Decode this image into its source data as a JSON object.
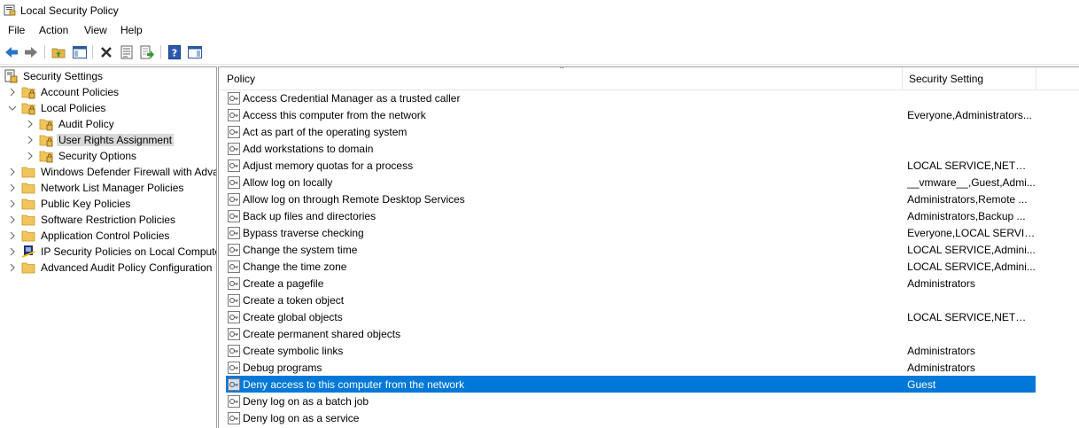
{
  "window": {
    "title": "Local Security Policy"
  },
  "menu": [
    "File",
    "Action",
    "View",
    "Help"
  ],
  "toolbar": {
    "icons": [
      "back-arrow-icon",
      "forward-arrow-icon",
      "up-folder-icon",
      "show-hide-console-tree-icon",
      "delete-icon",
      "properties-icon",
      "export-list-icon",
      "help-icon",
      "show-hide-action-pane-icon"
    ]
  },
  "tree": [
    {
      "label": "Security Settings",
      "level": 0,
      "expanded": true
    },
    {
      "label": "Account Policies",
      "level": 1,
      "expanded": false
    },
    {
      "label": "Local Policies",
      "level": 1,
      "expanded": true
    },
    {
      "label": "Audit Policy",
      "level": 2,
      "expanded": false
    },
    {
      "label": "User Rights Assignment",
      "level": 2,
      "expanded": false,
      "selected": true
    },
    {
      "label": "Security Options",
      "level": 2,
      "expanded": false
    },
    {
      "label": "Windows Defender Firewall with Adva",
      "level": 1,
      "expanded": false
    },
    {
      "label": "Network List Manager Policies",
      "level": 1,
      "expanded": false
    },
    {
      "label": "Public Key Policies",
      "level": 1,
      "expanded": false
    },
    {
      "label": "Software Restriction Policies",
      "level": 1,
      "expanded": false
    },
    {
      "label": "Application Control Policies",
      "level": 1,
      "expanded": false
    },
    {
      "label": "IP Security Policies on Local Compute",
      "level": 1,
      "expanded": false
    },
    {
      "label": "Advanced Audit Policy Configuration",
      "level": 1,
      "expanded": false
    }
  ],
  "list": {
    "columns": [
      "Policy",
      "Security Setting"
    ],
    "rows": [
      {
        "policy": "Access Credential Manager as a trusted caller",
        "setting": ""
      },
      {
        "policy": "Access this computer from the network",
        "setting": "Everyone,Administrators..."
      },
      {
        "policy": "Act as part of the operating system",
        "setting": ""
      },
      {
        "policy": "Add workstations to domain",
        "setting": ""
      },
      {
        "policy": "Adjust memory quotas for a process",
        "setting": "LOCAL SERVICE,NETWO..."
      },
      {
        "policy": "Allow log on locally",
        "setting": "__vmware__,Guest,Admi..."
      },
      {
        "policy": "Allow log on through Remote Desktop Services",
        "setting": "Administrators,Remote ..."
      },
      {
        "policy": "Back up files and directories",
        "setting": "Administrators,Backup ..."
      },
      {
        "policy": "Bypass traverse checking",
        "setting": "Everyone,LOCAL SERVIC..."
      },
      {
        "policy": "Change the system time",
        "setting": "LOCAL SERVICE,Admini..."
      },
      {
        "policy": "Change the time zone",
        "setting": "LOCAL SERVICE,Admini..."
      },
      {
        "policy": "Create a pagefile",
        "setting": "Administrators"
      },
      {
        "policy": "Create a token object",
        "setting": ""
      },
      {
        "policy": "Create global objects",
        "setting": "LOCAL SERVICE,NETWO..."
      },
      {
        "policy": "Create permanent shared objects",
        "setting": ""
      },
      {
        "policy": "Create symbolic links",
        "setting": "Administrators"
      },
      {
        "policy": "Debug programs",
        "setting": "Administrators"
      },
      {
        "policy": "Deny access to this computer from the network",
        "setting": "Guest",
        "selected": true
      },
      {
        "policy": "Deny log on as a batch job",
        "setting": ""
      },
      {
        "policy": "Deny log on as a service",
        "setting": ""
      }
    ]
  },
  "colors": {
    "selection": "#0078d7",
    "tree_selection": "#d9d9d9",
    "folder": "#e8b64a"
  }
}
